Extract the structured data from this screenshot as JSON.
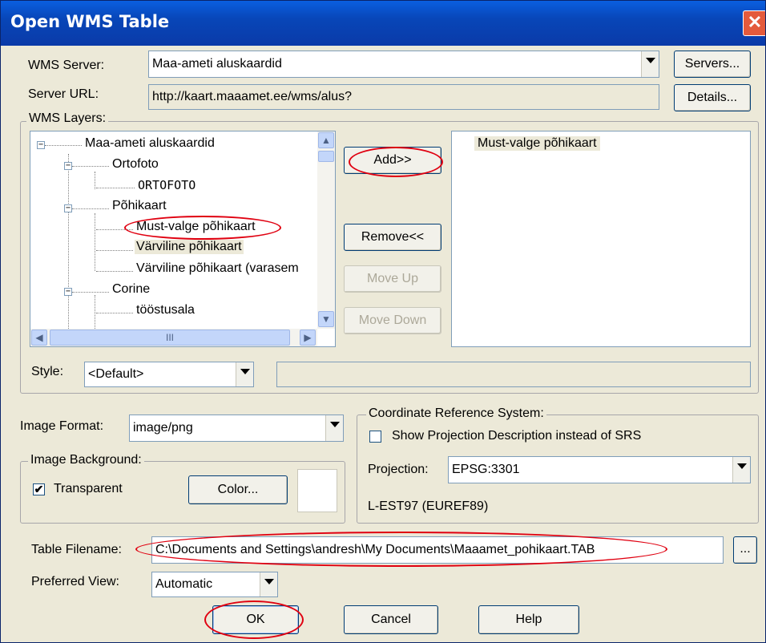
{
  "window": {
    "title": "Open WMS Table",
    "close_glyph": "✕"
  },
  "server": {
    "label": "WMS Server:",
    "value": "Maa-ameti aluskaardid",
    "servers_btn": "Servers...",
    "url_label": "Server URL:",
    "url_value": "http://kaart.maaamet.ee/wms/alus?",
    "details_btn": "Details..."
  },
  "layers": {
    "group_label": "WMS Layers:",
    "tree": [
      {
        "label": "Maa-ameti aluskaardid",
        "expander": "−"
      },
      {
        "label": "Ortofoto",
        "expander": "−"
      },
      {
        "label": "ORTOFOTO"
      },
      {
        "label": "Põhikaart",
        "expander": "−"
      },
      {
        "label": "Must-valge põhikaart"
      },
      {
        "label": "Värviline põhikaart"
      },
      {
        "label": "Värviline põhikaart (varasem"
      },
      {
        "label": "Corine",
        "expander": "−"
      },
      {
        "label": "tööstusala"
      }
    ],
    "scroll_up": "▲",
    "scroll_down": "▼",
    "scroll_left": "◀",
    "scroll_right": "▶",
    "thumb_grip": "III",
    "add_btn": "Add>>",
    "remove_btn": "Remove<<",
    "moveup_btn": "Move Up",
    "movedown_btn": "Move Down",
    "selected": [
      "Must-valge põhikaart"
    ],
    "style_label": "Style:",
    "style_value": "<Default>",
    "style_text": ""
  },
  "image": {
    "format_label": "Image Format:",
    "format_value": "image/png",
    "bg_group": "Image Background:",
    "transparent_label": "Transparent",
    "transparent_checked": "✔",
    "color_btn": "Color..."
  },
  "crs": {
    "group_label": "Coordinate Reference System:",
    "show_desc_label": "Show Projection Description instead of SRS",
    "projection_label": "Projection:",
    "projection_value": "EPSG:3301",
    "description": "L-EST97 (EUREF89)"
  },
  "table": {
    "filename_label": "Table Filename:",
    "filename_value": "C:\\Documents and Settings\\andresh\\My Documents\\Maaamet_pohikaart.TAB",
    "browse_btn": "..."
  },
  "view": {
    "label": "Preferred View:",
    "value": "Automatic"
  },
  "buttons": {
    "ok": "OK",
    "cancel": "Cancel",
    "help": "Help"
  },
  "colors": {
    "title_blue": "#0a46b8",
    "dialog_bg": "#ece9d8",
    "highlight": "#e00010",
    "selection_bg": "#ece9d8"
  }
}
